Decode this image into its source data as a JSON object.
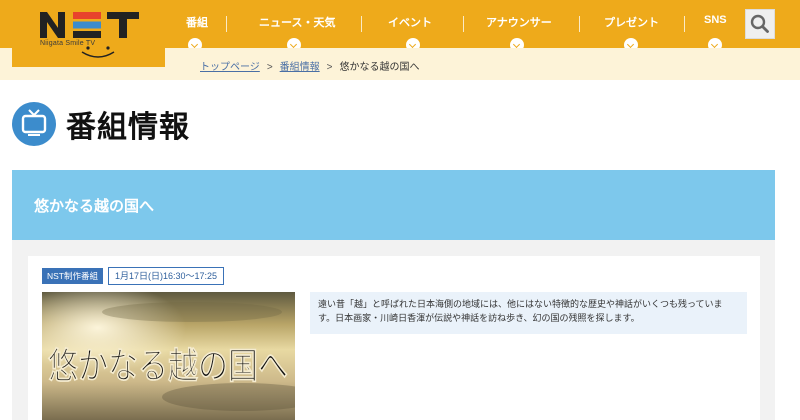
{
  "brand": {
    "logo_text": "NST",
    "tagline": "Niigata Smile TV",
    "colors": {
      "header": "#eeaa1b",
      "logo_n": "#222222",
      "logo_s1": "#e8432c",
      "logo_s2": "#3c8ccc",
      "logo_t": "#222222"
    }
  },
  "nav": {
    "items": [
      {
        "label": "番組"
      },
      {
        "label": "ニュース・天気"
      },
      {
        "label": "イベント"
      },
      {
        "label": "アナウンサー"
      },
      {
        "label": "プレゼント"
      },
      {
        "label": "SNS"
      }
    ],
    "search_icon": "search-icon"
  },
  "breadcrumb": {
    "items": [
      {
        "label": "トップページ",
        "link": true
      },
      {
        "label": "番組情報",
        "link": true
      },
      {
        "label": "悠かなる越の国へ",
        "link": false
      }
    ],
    "separator": ">"
  },
  "page": {
    "title": "番組情報",
    "title_icon": "tv-icon"
  },
  "program": {
    "title": "悠かなる越の国へ",
    "badge": "NST制作番組",
    "airtime": "1月17日(日)16:30～17:25",
    "thumbnail_title": "悠かなる越の国へ",
    "description": "遠い昔「越」と呼ばれた日本海側の地域には、他にはない特徴的な歴史や神話がいくつも残っています。日本画家・川崎日香渾が伝説や神話を訪ね歩き、幻の国の残照を探します。"
  }
}
